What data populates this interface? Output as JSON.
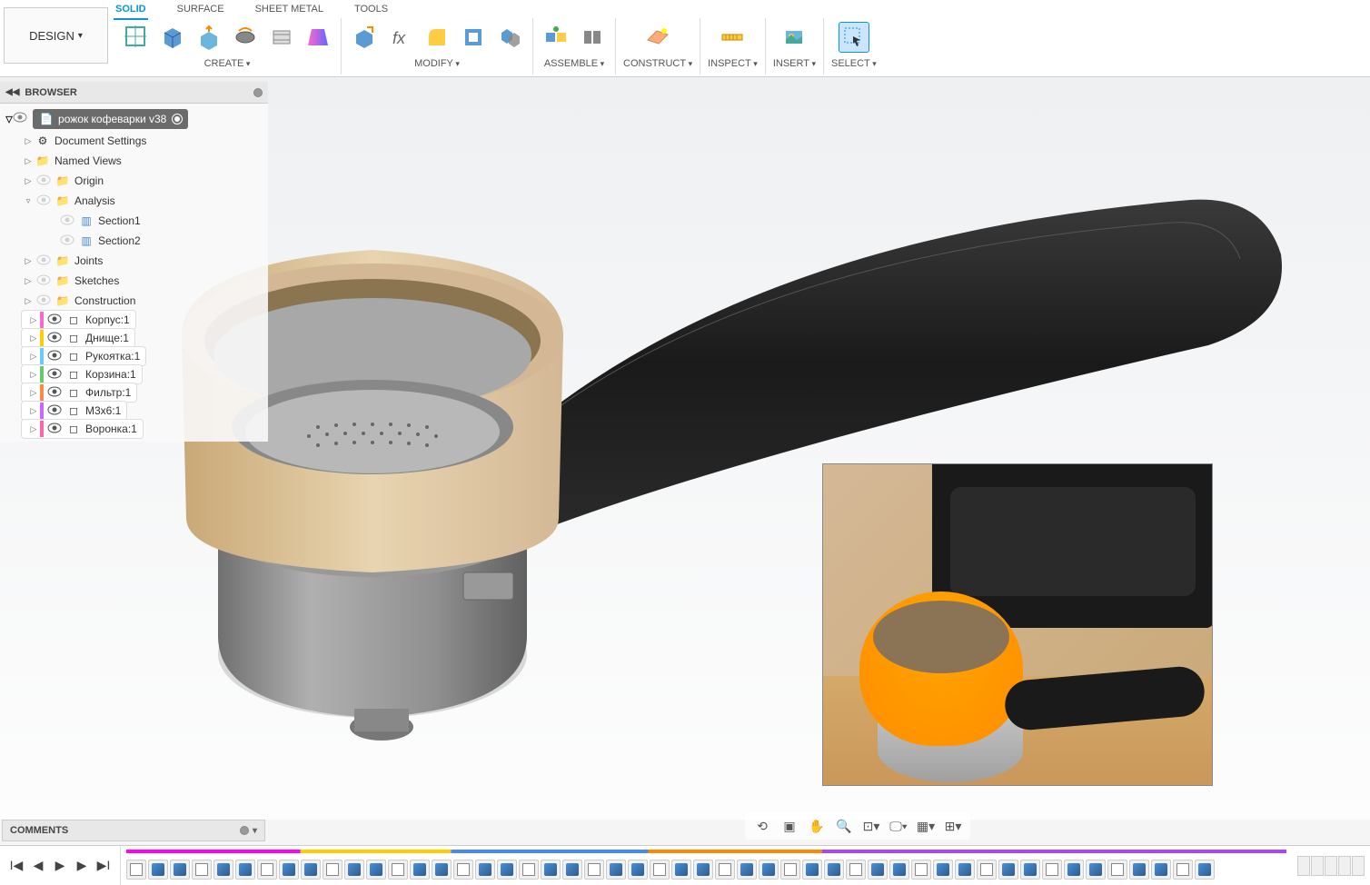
{
  "toolbar": {
    "design_label": "DESIGN",
    "tabs": [
      "SOLID",
      "SURFACE",
      "SHEET METAL",
      "TOOLS"
    ],
    "active_tab": 0,
    "groups": {
      "create": "CREATE",
      "modify": "MODIFY",
      "assemble": "ASSEMBLE",
      "construct": "CONSTRUCT",
      "inspect": "INSPECT",
      "insert": "INSERT",
      "select": "SELECT"
    }
  },
  "browser": {
    "title": "BROWSER",
    "root": "рожок кофеварки v38",
    "items": {
      "doc_settings": "Document Settings",
      "named_views": "Named Views",
      "origin": "Origin",
      "analysis": "Analysis",
      "section1": "Section1",
      "section2": "Section2",
      "joints": "Joints",
      "sketches": "Sketches",
      "construction": "Construction",
      "comp1": "Корпус:1",
      "comp2": "Днище:1",
      "comp3": "Рукоятка:1",
      "comp4": "Корзина:1",
      "comp5": "Фильтр:1",
      "comp6": "М3х6:1",
      "comp7": "Воронка:1"
    },
    "comp_colors": [
      "#ff66cc",
      "#ffcc00",
      "#66ccff",
      "#66cc66",
      "#ff8844",
      "#cc66ff",
      "#ff66aa"
    ]
  },
  "comments": {
    "title": "COMMENTS"
  },
  "view_tools": [
    "orbit-icon",
    "look-at-icon",
    "pan-icon",
    "zoom-icon",
    "fit-icon",
    "display-icon",
    "grid-icon",
    "viewport-icon"
  ],
  "timeline": {
    "controls": [
      "start",
      "prev",
      "play",
      "next",
      "end"
    ]
  }
}
